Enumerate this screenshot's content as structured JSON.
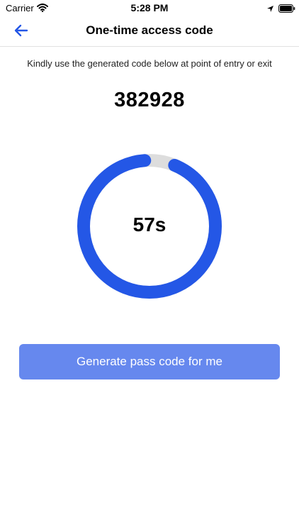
{
  "status_bar": {
    "carrier": "Carrier",
    "time": "5:28 PM",
    "icons": [
      "wifi-icon",
      "location-icon",
      "battery-icon"
    ]
  },
  "header": {
    "back_icon": "arrow-left-icon",
    "title": "One-time access code"
  },
  "main": {
    "instructions": "Kindly use the generated code below at point of entry or exit",
    "code": "382928",
    "timer": {
      "label": "57s",
      "fraction_remaining": 0.95
    },
    "generate_button_label": "Generate pass code for me"
  },
  "colors": {
    "accent": "#2457e6",
    "button": "#6688ee",
    "track": "#dddddd"
  }
}
